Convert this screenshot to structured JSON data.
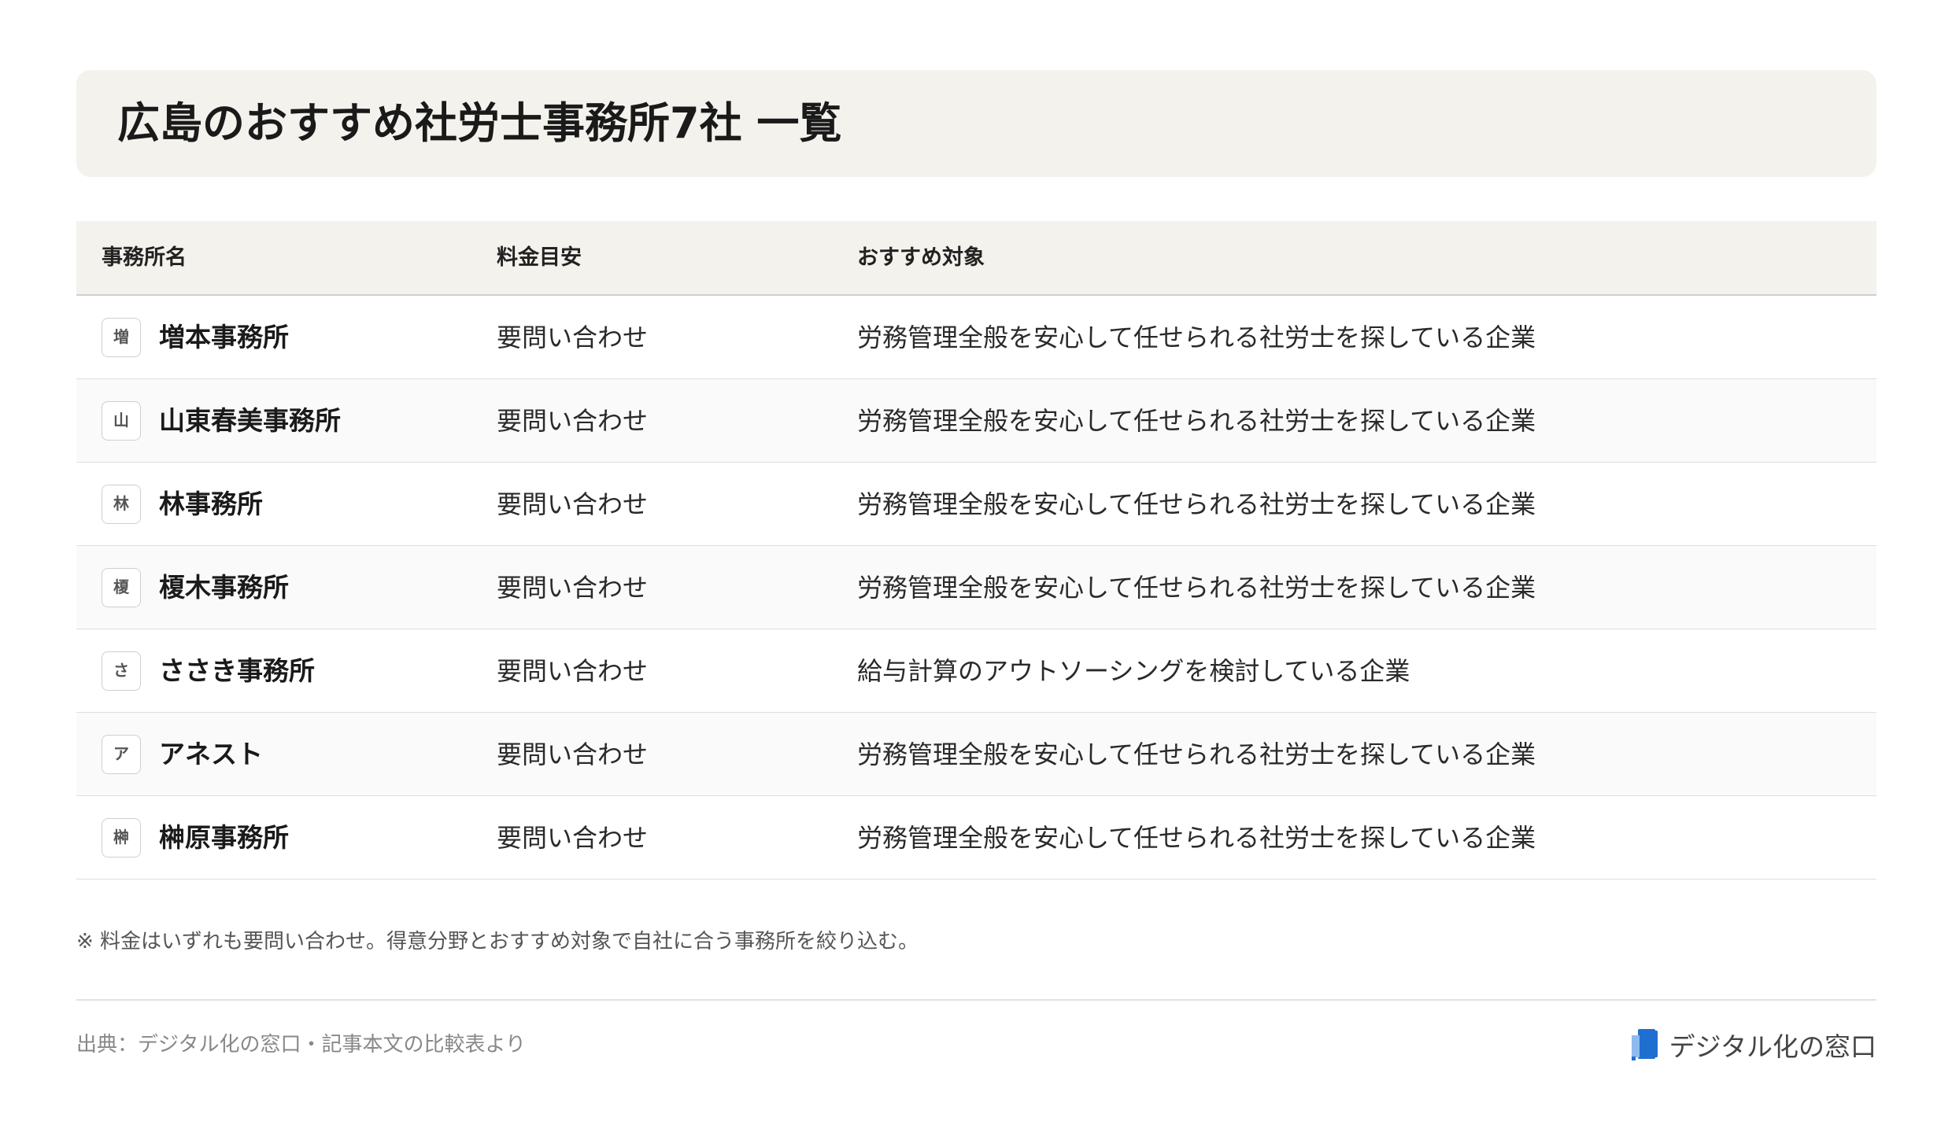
{
  "title": "広島のおすすめ社労士事務所7社 一覧",
  "table": {
    "headers": [
      "事務所名",
      "料金目安",
      "おすすめ対象"
    ],
    "rows": [
      {
        "badge": "増",
        "name": "増本事務所",
        "fee": "要問い合わせ",
        "target": "労務管理全般を安心して任せられる社労士を探している企業"
      },
      {
        "badge": "山",
        "name": "山東春美事務所",
        "fee": "要問い合わせ",
        "target": "労務管理全般を安心して任せられる社労士を探している企業"
      },
      {
        "badge": "林",
        "name": "林事務所",
        "fee": "要問い合わせ",
        "target": "労務管理全般を安心して任せられる社労士を探している企業"
      },
      {
        "badge": "榎",
        "name": "榎木事務所",
        "fee": "要問い合わせ",
        "target": "労務管理全般を安心して任せられる社労士を探している企業"
      },
      {
        "badge": "さ",
        "name": "ささき事務所",
        "fee": "要問い合わせ",
        "target": "給与計算のアウトソーシングを検討している企業"
      },
      {
        "badge": "ア",
        "name": "アネスト",
        "fee": "要問い合わせ",
        "target": "労務管理全般を安心して任せられる社労士を探している企業"
      },
      {
        "badge": "榊",
        "name": "榊原事務所",
        "fee": "要問い合わせ",
        "target": "労務管理全般を安心して任せられる社労士を探している企業"
      }
    ]
  },
  "note": "※ 料金はいずれも要問い合わせ。得意分野とおすすめ対象で自社に合う事務所を絞り込む。",
  "source": "出典：デジタル化の窓口・記事本文の比較表より",
  "logo": {
    "text": "デジタル化の窓口",
    "icon": "logo-mark-icon",
    "color": "#1f6fd1"
  }
}
